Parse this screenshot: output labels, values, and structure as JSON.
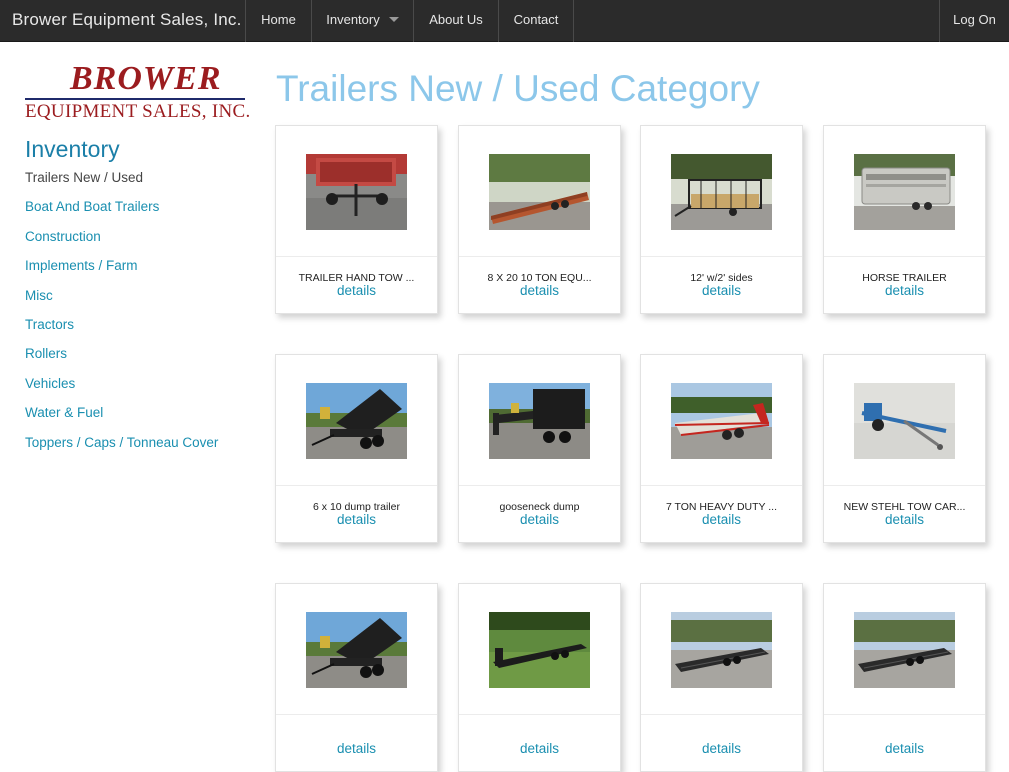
{
  "nav": {
    "brand": "Brower Equipment Sales, Inc.",
    "items": [
      {
        "label": "Home"
      },
      {
        "label": "Inventory"
      },
      {
        "label": "About Us"
      },
      {
        "label": "Contact"
      }
    ],
    "login": "Log On"
  },
  "logo": {
    "top": "BROWER",
    "bottom": "EQUIPMENT SALES, INC."
  },
  "sidebar": {
    "heading": "Inventory",
    "items": [
      {
        "label": "Trailers New / Used",
        "active": true
      },
      {
        "label": "Boat And Boat Trailers"
      },
      {
        "label": "Construction"
      },
      {
        "label": "Implements / Farm"
      },
      {
        "label": "Misc"
      },
      {
        "label": "Tractors"
      },
      {
        "label": "Rollers"
      },
      {
        "label": "Vehicles"
      },
      {
        "label": "Water & Fuel"
      },
      {
        "label": "Toppers / Caps / Tonneau Cover"
      }
    ]
  },
  "main": {
    "title": "Trailers New / Used Category",
    "details_label": "details",
    "products": [
      {
        "name": "TRAILER HAND TOW ...",
        "image": "hand-tow-trailer-photo"
      },
      {
        "name": "8 X 20 10 TON EQU...",
        "image": "equipment-trailer-photo"
      },
      {
        "name": "12' w/2' sides",
        "image": "utility-trailer-photo"
      },
      {
        "name": "HORSE TRAILER",
        "image": "horse-trailer-photo"
      },
      {
        "name": "6 x 10 dump trailer",
        "image": "dump-trailer-photo"
      },
      {
        "name": "gooseneck dump",
        "image": "gooseneck-dump-photo"
      },
      {
        "name": "7 TON HEAVY DUTY ...",
        "image": "heavy-duty-trailer-photo"
      },
      {
        "name": "NEW STEHL TOW CAR...",
        "image": "tow-dolly-photo"
      },
      {
        "name": "",
        "image": "dump-trailer-photo"
      },
      {
        "name": "",
        "image": "gooseneck-flatbed-photo"
      },
      {
        "name": "",
        "image": "flatbed-trailer-photo"
      },
      {
        "name": "",
        "image": "flatbed-trailer-photo"
      }
    ]
  }
}
